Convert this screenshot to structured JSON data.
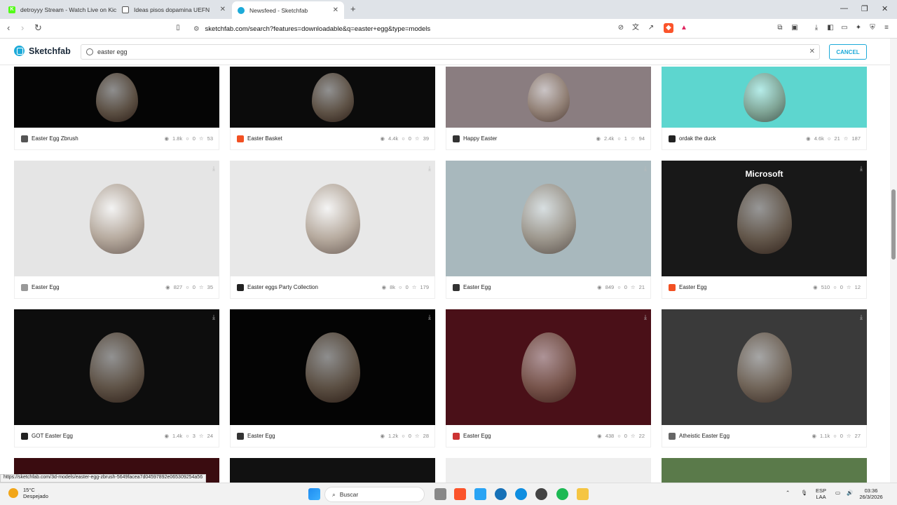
{
  "browser": {
    "tabs": [
      {
        "title": "detroyyy Stream - Watch Live on Kick",
        "active": false,
        "favicon_color": "#53fc18"
      },
      {
        "title": "Ideas pisos dopamina UEFN",
        "active": false,
        "favicon_color": "#555555"
      },
      {
        "title": "Newsfeed - Sketchfab",
        "active": true,
        "favicon_color": "#1caad9"
      }
    ],
    "url": "sketchfab.com/search?features=downloadable&q=easter+egg&type=models",
    "status_url": "https://sketchfab.com/3d-models/easter-egg-zbrush-5649facea7d04597892e065309254a56"
  },
  "sketchfab": {
    "logo_text": "Sketchfab",
    "search_value": "easter egg",
    "cancel_label": "CANCEL"
  },
  "cards": [
    {
      "title": "Easter Egg Zbrush",
      "views": "1.8k",
      "comments": "0",
      "likes": "53",
      "bg": "#050505",
      "av": "#555"
    },
    {
      "title": "Easter Basket",
      "views": "4.4k",
      "comments": "0",
      "likes": "39",
      "bg": "#0b0b0b",
      "av": "#f25022"
    },
    {
      "title": "Happy Easter",
      "views": "2.4k",
      "comments": "1",
      "likes": "94",
      "bg": "#8a7d80",
      "av": "#333"
    },
    {
      "title": "ordak the duck",
      "views": "4.6k",
      "comments": "21",
      "likes": "187",
      "bg": "#5dd6cf",
      "av": "#222"
    },
    {
      "title": "Easter Egg",
      "views": "827",
      "comments": "0",
      "likes": "35",
      "bg": "#e5e5e5",
      "av": "#999"
    },
    {
      "title": "Easter eggs Party Collection",
      "views": "8k",
      "comments": "0",
      "likes": "179",
      "bg": "#e8e8e8",
      "av": "#222"
    },
    {
      "title": "Easter Egg",
      "views": "849",
      "comments": "0",
      "likes": "21",
      "bg": "#a8b8bd",
      "av": "#333"
    },
    {
      "title": "Easter Egg",
      "views": "510",
      "comments": "0",
      "likes": "12",
      "bg": "#181818",
      "av": "#f25022",
      "brand": "Microsoft"
    },
    {
      "title": "GOT Easter Egg",
      "views": "1.4k",
      "comments": "3",
      "likes": "24",
      "bg": "#0d0d0d",
      "av": "#222"
    },
    {
      "title": "Easter Egg",
      "views": "1.2k",
      "comments": "0",
      "likes": "28",
      "bg": "#040404",
      "av": "#333"
    },
    {
      "title": "Easter Egg",
      "views": "438",
      "comments": "0",
      "likes": "22",
      "bg": "#4a1018",
      "av": "#c33"
    },
    {
      "title": "Atheistic Easter Egg",
      "views": "1.1k",
      "comments": "0",
      "likes": "27",
      "bg": "#3a3a3a",
      "av": "#666"
    }
  ],
  "taskbar": {
    "temperature": "15°C",
    "weather": "Despejado",
    "search_placeholder": "Buscar",
    "lang": "ESP",
    "region": "LAA",
    "time": "03:36",
    "date": "26/3/2026"
  }
}
